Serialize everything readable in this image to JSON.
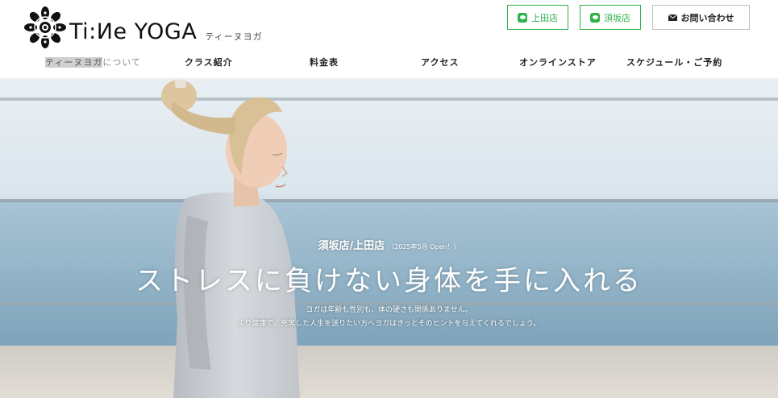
{
  "header": {
    "logo_text": "Ti:Иe YOGA",
    "logo_sub": "ティーヌヨガ",
    "buttons": {
      "ueda": "上田店",
      "suzaka": "須坂店",
      "contact": "お問い合わせ"
    }
  },
  "nav": {
    "about_highlight": "ティーヌヨガ",
    "about_rest": "について",
    "class": "クラス紹介",
    "price": "料金表",
    "access": "アクセス",
    "store": "オンラインストア",
    "schedule": "スケジュール・ご予約"
  },
  "hero": {
    "stores": "須坂店/上田店",
    "open_note": "（2025年5月 Open！）",
    "headline": "ストレスに負けない身体を手に入れる",
    "sub1": "ヨガは年齢も性別も、体の硬さも関係ありません。",
    "sub2": "より健康で、充実した人生を送りたい方へヨガはきっとそのヒントを与えてくれるでしょう。"
  },
  "colors": {
    "line_green": "#2fb24a",
    "text_dark": "#222222"
  },
  "icons": {
    "logo": "mandala-logo-icon",
    "line": "line-icon",
    "mail": "mail-icon"
  }
}
